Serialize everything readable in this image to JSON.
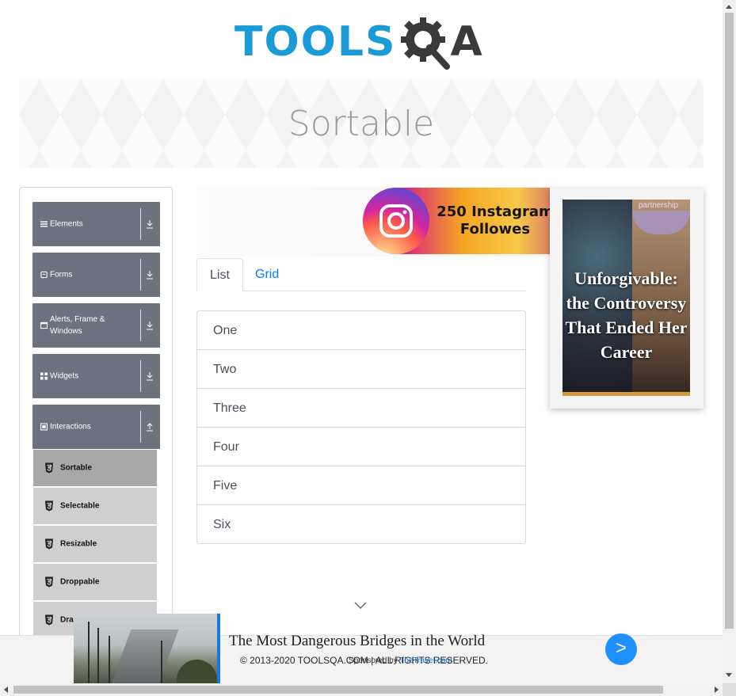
{
  "header": {
    "logo_text_main": "TOOLS",
    "logo_text_end": "A",
    "page_title": "Sortable"
  },
  "sidebar": {
    "groups": [
      {
        "label": "Elements",
        "icon": "list-icon",
        "state": "collapsed"
      },
      {
        "label": "Forms",
        "icon": "form-icon",
        "state": "collapsed"
      },
      {
        "label": "Alerts, Frame & Windows",
        "icon": "window-icon",
        "state": "collapsed"
      },
      {
        "label": "Widgets",
        "icon": "grid-icon",
        "state": "collapsed"
      },
      {
        "label": "Interactions",
        "icon": "box-icon",
        "state": "expanded"
      }
    ],
    "items": [
      {
        "label": "Sortable",
        "active": true
      },
      {
        "label": "Selectable",
        "active": false
      },
      {
        "label": "Resizable",
        "active": false
      },
      {
        "label": "Droppable",
        "active": false
      },
      {
        "label": "Dra",
        "active": false
      }
    ]
  },
  "ads": {
    "instagram_text": "250 Instagram Followes",
    "right_partner": "partnership",
    "right_headline": "Unforgivable: the Controversy That Ended Her Career",
    "bottom_title": "The Most Dangerous Bridges in the World",
    "bottom_sponsor_prefix": "Sponsored by",
    "bottom_sponsor_source": "TheTravel.com",
    "bottom_go": ">"
  },
  "tabs": [
    {
      "label": "List",
      "active": true
    },
    {
      "label": "Grid",
      "active": false
    }
  ],
  "list_items": [
    "One",
    "Two",
    "Three",
    "Four",
    "Five",
    "Six"
  ],
  "footer": {
    "copyright": "© 2013-2020 TOOLSQA.COM | ALL RIGHTS RESERVED."
  },
  "colors": {
    "brand_blue": "#1a9ad6",
    "menu_group": "#6c737e",
    "menu_item": "#cfcfcf",
    "menu_item_active": "#a8a8a8",
    "link": "#007bff"
  }
}
